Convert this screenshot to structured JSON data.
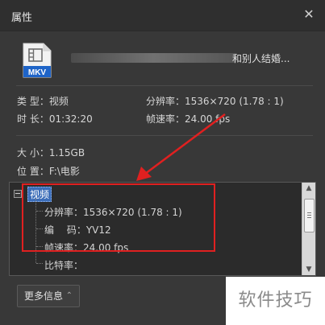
{
  "window": {
    "title": "属性",
    "close_glyph": "✕"
  },
  "file": {
    "icon_label": "MKV",
    "name_visible_suffix": "和别人结婚..."
  },
  "summary": {
    "type_label": "类 型：",
    "type_value": "视频",
    "duration_label": "时 长：",
    "duration_value": "01:32:20",
    "resolution_label": "分辨率：",
    "resolution_value": "1536×720 (1.78 : 1)",
    "framerate_label": "帧速率：",
    "framerate_value": "24.00 fps",
    "size_label": "大 小：",
    "size_value": "1.15GB",
    "location_label": "位 置：",
    "location_value": "F:\\电影"
  },
  "tree": {
    "root_label": "视频",
    "items": [
      {
        "label": "分辨率：",
        "value": "1536×720 (1.78 : 1)"
      },
      {
        "label": "编　 码：",
        "value": "YV12"
      },
      {
        "label": "帧速率：",
        "value": "24.00 fps"
      },
      {
        "label": "比特率：",
        "value": ""
      }
    ]
  },
  "buttons": {
    "more_info": "更多信息",
    "more_chevron": "⌃"
  },
  "watermark": "软件技巧",
  "colors": {
    "annotation_red": "#e02020",
    "selection_blue": "#3b6db8",
    "dialog_bg": "#383838",
    "icon_blue": "#1e64c8"
  }
}
